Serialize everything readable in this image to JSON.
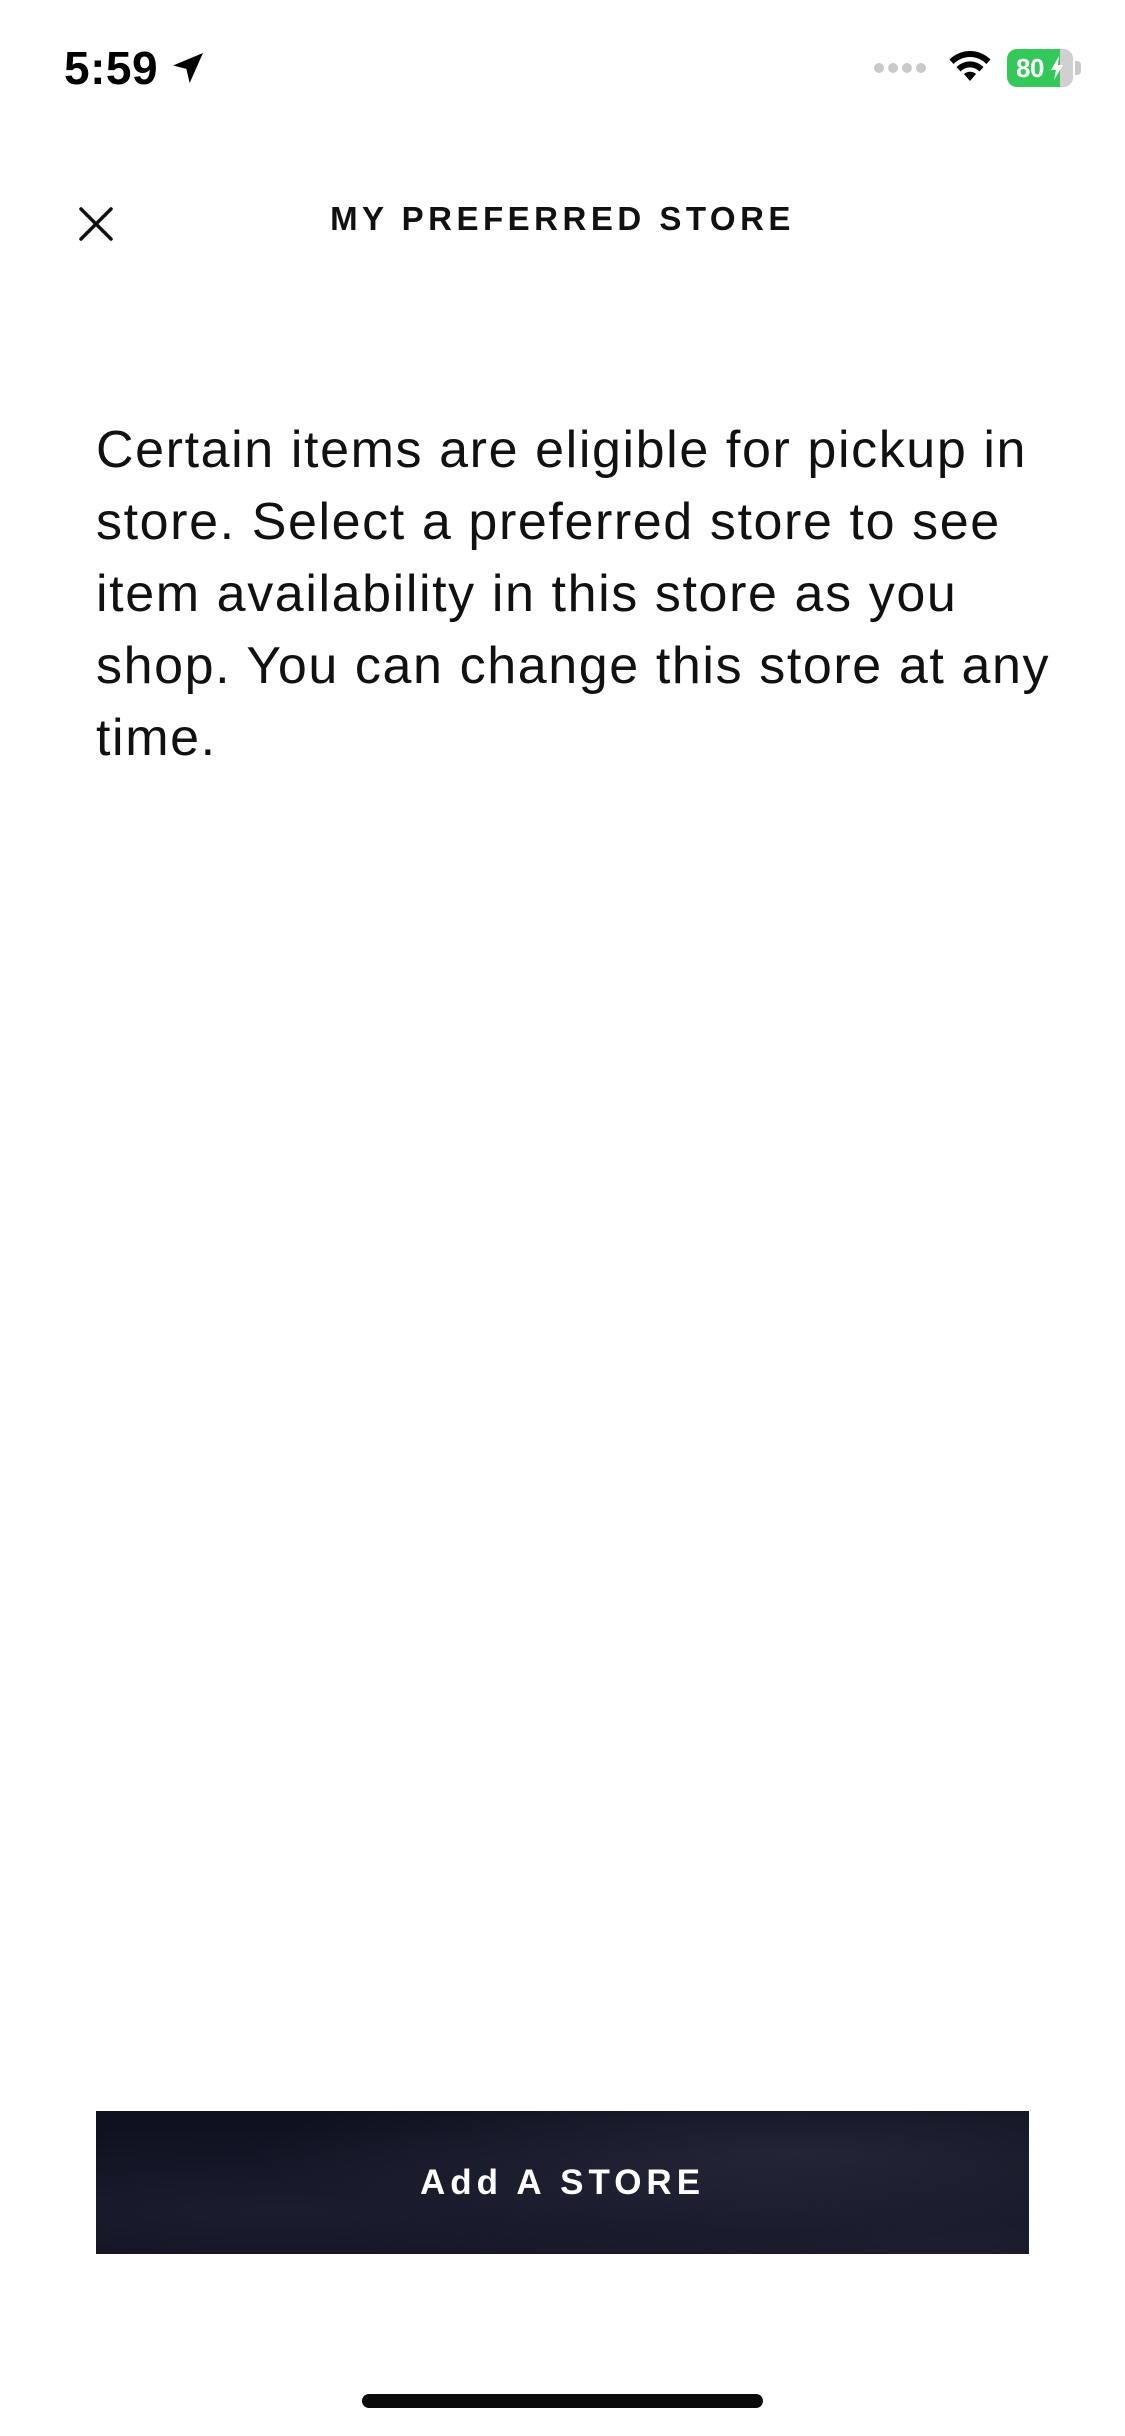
{
  "status_bar": {
    "time": "5:59",
    "battery_percent": "80",
    "battery_level": 0.8,
    "icons": {
      "location": "location-arrow-icon",
      "signal": "signal-dots-icon",
      "wifi": "wifi-icon",
      "battery": "battery-charging-icon"
    }
  },
  "header": {
    "title": "MY PREFERRED STORE",
    "close_icon": "close-icon"
  },
  "main": {
    "description": "Certain items are eligible for pickup in store. Select a preferred store to see item availability in this store as you shop. You can change this store at any time."
  },
  "footer": {
    "add_store_label": "Add A STORE"
  },
  "colors": {
    "background": "#ffffff",
    "text": "#111111",
    "button_bg": "#0f1020",
    "button_text": "#ffffff",
    "battery_green": "#34c759"
  }
}
